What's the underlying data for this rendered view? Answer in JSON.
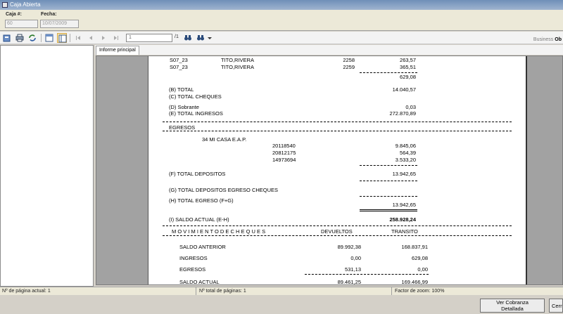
{
  "window": {
    "title": "Caja Abierta"
  },
  "header": {
    "caja_label": "Caja #:",
    "caja_value": "60",
    "fecha_label": "Fecha:",
    "fecha_value": "10/07/2009"
  },
  "toolbar": {
    "page_input_value": "1",
    "page_total": "/1",
    "brand_prefix": "Business ",
    "brand_suffix": "Ob"
  },
  "tabs": [
    {
      "label": "Informe principal"
    }
  ],
  "report": {
    "rows_top": [
      {
        "code": "S07_23",
        "name": "TITO,RIVERA",
        "num": "2258",
        "amount": "263,57"
      },
      {
        "code": "S07_23",
        "name": "TITO,RIVERA",
        "num": "2259",
        "amount": "365,51"
      }
    ],
    "subtotal": "629,08",
    "total_b_label": "(B) TOTAL",
    "total_b_value": "14.040,57",
    "total_c_label": "(C) TOTAL CHEQUES",
    "sobrante_label": "(D) Sobrante",
    "sobrante_value": "0,03",
    "total_e_label": "(E) TOTAL INGRESOS",
    "total_e_value": "272.870,89",
    "egresos_label": "EGRESOS",
    "egreso_entity": "34   MI CASA E.A.P.",
    "deposits": [
      {
        "num": "20118540",
        "amount": "9.845,06"
      },
      {
        "num": "20812175",
        "amount": "564,39"
      },
      {
        "num": "14973694",
        "amount": "3.533,20"
      }
    ],
    "total_f_label": "(F) TOTAL DEPOSITOS",
    "total_f_value": "13.942,65",
    "total_g_label": "(G) TOTAL DEPOSITOS EGRESO CHEQUES",
    "total_h_label": "(H) TOTAL EGRESO (F+G)",
    "total_h_value": "13.942,65",
    "saldo_label": "(I) SALDO ACTUAL (E-H)",
    "saldo_value": "258.928,24",
    "mov_title": "M O V I M I E N T O    D E    C H E Q U E S",
    "col_devueltos": "DEVUELTOS",
    "col_transito": "TRANSITO",
    "mov_rows": [
      {
        "label": "SALDO ANTERIOR",
        "devueltos": "89.992,38",
        "transito": "168.837,91"
      },
      {
        "label": "INGRESOS",
        "devueltos": "0,00",
        "transito": "629,08"
      },
      {
        "label": "EGRESOS",
        "devueltos": "531,13",
        "transito": "0,00"
      },
      {
        "label": "SALDO ACTUAL",
        "devueltos": "89.461,25",
        "transito": "169.466,99"
      }
    ]
  },
  "status": {
    "current_page": "Nº de página actual: 1",
    "total_pages": "Nº total de páginas: 1",
    "zoom": "Factor de zoom: 100%"
  },
  "buttons": {
    "detail_label": "Ver Cobranza Detallada",
    "close_label": "Cerrar"
  }
}
